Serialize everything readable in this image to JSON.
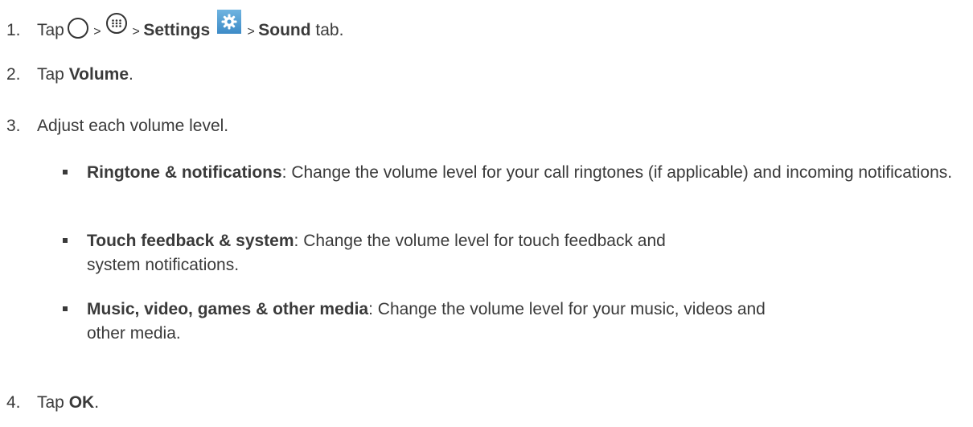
{
  "steps": [
    {
      "num": "1.",
      "parts": {
        "tap": "Tap",
        "sep1": " > ",
        "sep2": " > ",
        "settings": "Settings",
        "sep3": " > ",
        "sound": "Sound",
        "tab": " tab."
      },
      "icons": [
        "home-circle-icon",
        "apps-icon",
        "settings-gear-icon"
      ]
    },
    {
      "num": "2.",
      "tap": "Tap ",
      "bold": "Volume",
      "end": "."
    },
    {
      "num": "3.",
      "text": "Adjust each volume level."
    },
    {
      "num": "4.",
      "tap": "Tap ",
      "bold": "OK",
      "end": "."
    }
  ],
  "bullets": [
    {
      "term": "Ringtone & notifications",
      "desc": ": Change the volume level for your call ringtones (if applicable) and incoming notifications."
    },
    {
      "term": "Touch feedback & system",
      "desc": ": Change the volume level for touch feedback and system notifications."
    },
    {
      "term": "Music, video, games & other media",
      "desc": ": Change the volume level for your music, videos and other media."
    }
  ],
  "colors": {
    "text": "#3a3a3a",
    "settings_icon": "#4a97d0"
  }
}
